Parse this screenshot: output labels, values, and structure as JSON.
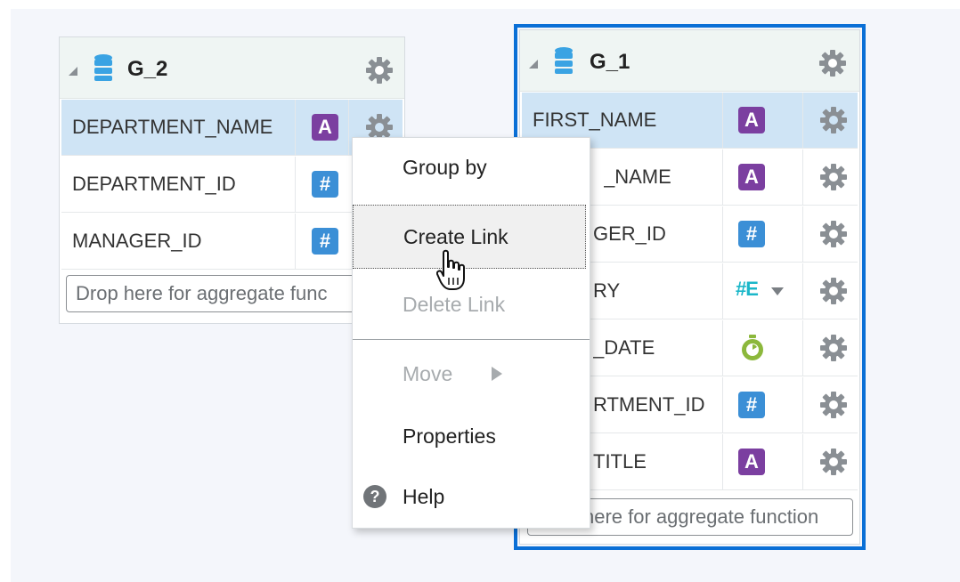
{
  "group2": {
    "title": "G_2",
    "rows": [
      {
        "name": "DEPARTMENT_NAME",
        "type": "A",
        "type_icon": "text-type-icon"
      },
      {
        "name": "DEPARTMENT_ID",
        "type": "#",
        "type_icon": "number-type-icon"
      },
      {
        "name": "MANAGER_ID",
        "type": "#",
        "type_icon": "number-type-icon"
      }
    ],
    "drop_placeholder": "Drop here for aggregate func"
  },
  "group1": {
    "title": "G_1",
    "rows": [
      {
        "name": "FIRST_NAME",
        "type": "A",
        "type_icon": "text-type-icon"
      },
      {
        "name": "_NAME",
        "type": "A",
        "type_icon": "text-type-icon"
      },
      {
        "name": "GER_ID",
        "type": "#",
        "type_icon": "number-type-icon"
      },
      {
        "name": "RY",
        "type": "#E",
        "type_icon": "expression-type-icon"
      },
      {
        "name": "_DATE",
        "type": "",
        "type_icon": "date-type-icon"
      },
      {
        "name": "RTMENT_ID",
        "type": "#",
        "type_icon": "number-type-icon"
      },
      {
        "name": "TITLE",
        "type": "A",
        "type_icon": "text-type-icon"
      }
    ],
    "drop_placeholder": "here for aggregate function"
  },
  "context_menu": {
    "items": [
      {
        "label": "Group by",
        "state": "enabled"
      },
      {
        "label": "Create Link",
        "state": "focused"
      },
      {
        "label": "Delete Link",
        "state": "disabled"
      },
      {
        "label": "Move",
        "state": "disabled",
        "submenu": true
      },
      {
        "label": "Properties",
        "state": "enabled"
      },
      {
        "label": "Help",
        "state": "enabled",
        "icon": "help-icon"
      }
    ],
    "help_glyph": "?"
  },
  "colors": {
    "selected_row": "#cfe4f5",
    "active_border": "#0a6fd6",
    "text_badge": "#7b3fa0",
    "number_badge": "#3b8fd6",
    "expression_badge": "#1bb7c9",
    "date_icon": "#8cb83c",
    "gear": "#8a8f94",
    "database": "#3aa3e3"
  }
}
